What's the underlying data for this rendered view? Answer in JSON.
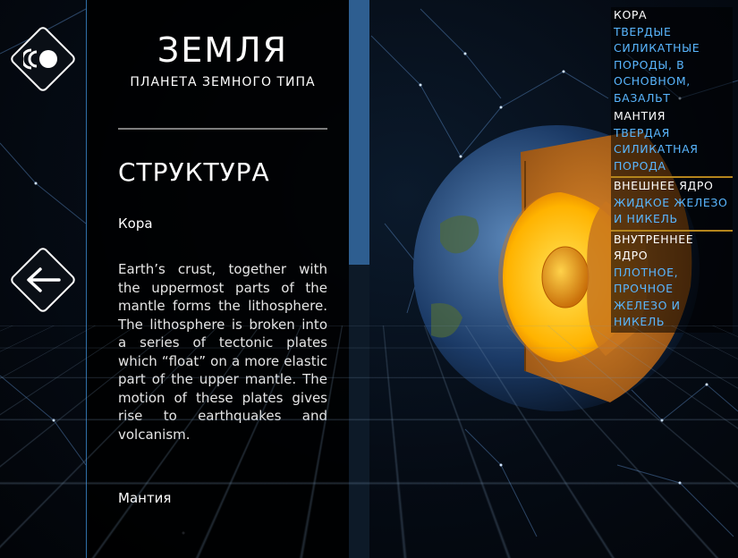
{
  "planet": {
    "title": "ЗЕМЛЯ",
    "subtitle": "ПЛАНЕТА ЗЕМНОГО ТИПА"
  },
  "section": {
    "title": "СТРУКТУРА",
    "items": [
      {
        "label": "Кора",
        "text": "Earth’s crust, together with the uppermost parts of the mantle forms the lithosphere. The lithosphere is broken into a series of tectonic plates which “float” on a more elastic part of the upper mantle. The motion of these plates gives rise to earthquakes and volcanism."
      },
      {
        "label": "Мантия"
      }
    ]
  },
  "legend": [
    {
      "heading": "КОРА",
      "value": "ТВЕРДЫЕ СИЛИКАТНЫЕ ПОРОДЫ, В ОСНОВНОМ, БАЗАЛЬТ"
    },
    {
      "heading": "МАНТИЯ",
      "value": "ТВЕРДАЯ СИЛИКАТНАЯ ПОРОДА"
    },
    {
      "heading": "ВНЕШНЕЕ ЯДРО",
      "value": "ЖИДКОЕ ЖЕЛЕЗО И НИКЕЛЬ"
    },
    {
      "heading": "ВНУТРЕННЕЕ ЯДРО",
      "value": "ПЛОТНОЕ, ПРОЧНОЕ ЖЕЛЕЗО И НИКЕЛЬ"
    }
  ],
  "icons": {
    "top": "view-mode-icon",
    "back": "arrow-left-icon"
  },
  "colors": {
    "accent_blue": "#59b6ff",
    "panel_border": "#2f6fa8",
    "scroll_thumb": "#2e5e90",
    "core_yellow": "#ffcc00",
    "mantle_orange": "#c8761e"
  }
}
